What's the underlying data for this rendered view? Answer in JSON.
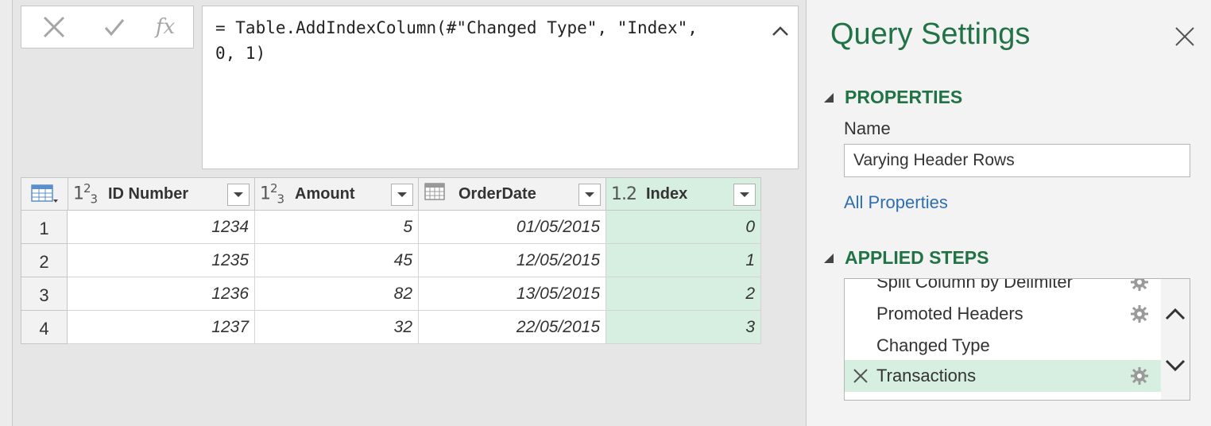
{
  "formula_bar": {
    "cancel_icon": "x-icon",
    "commit_icon": "check-icon",
    "fx_label": "fx",
    "formula": "= Table.AddIndexColumn(#\"Changed Type\", \"Index\",\n0, 1)"
  },
  "table": {
    "columns": [
      {
        "type_label": "1²₃",
        "name": "ID Number",
        "type": "whole-number"
      },
      {
        "type_label": "1²₃",
        "name": "Amount",
        "type": "whole-number"
      },
      {
        "type_label": "date",
        "name": "OrderDate",
        "type": "date"
      },
      {
        "type_label": "1.2",
        "name": "Index",
        "type": "decimal-number"
      }
    ],
    "rows": [
      {
        "num": "1",
        "cells": [
          "1234",
          "5",
          "01/05/2015",
          "0"
        ]
      },
      {
        "num": "2",
        "cells": [
          "1235",
          "45",
          "12/05/2015",
          "1"
        ]
      },
      {
        "num": "3",
        "cells": [
          "1236",
          "82",
          "13/05/2015",
          "2"
        ]
      },
      {
        "num": "4",
        "cells": [
          "1237",
          "32",
          "22/05/2015",
          "3"
        ]
      }
    ],
    "highlight_color": "#d6efe0"
  },
  "settings": {
    "title": "Query Settings",
    "properties_heading": "PROPERTIES",
    "name_label": "Name",
    "name_value": "Varying Header Rows",
    "all_properties_link": "All Properties",
    "applied_steps_heading": "APPLIED STEPS",
    "steps": [
      {
        "label": "Split Column by Delimiter",
        "has_gear": true,
        "selected": false
      },
      {
        "label": "Promoted Headers",
        "has_gear": true,
        "selected": false
      },
      {
        "label": "Changed Type",
        "has_gear": false,
        "selected": false
      },
      {
        "label": "Transactions",
        "has_gear": true,
        "selected": true
      }
    ],
    "accent_color": "#217346",
    "link_color": "#2e6fb1"
  }
}
